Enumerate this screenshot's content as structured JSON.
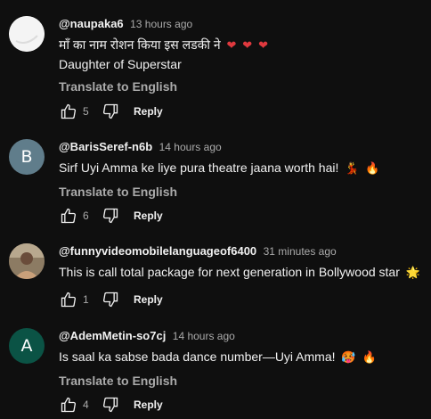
{
  "colors": {
    "background": "#0f0f0f",
    "text": "#f1f1f1",
    "secondary": "#aaaaaa",
    "heart": "#e0393e"
  },
  "comments": [
    {
      "author": "@naupaka6",
      "time": "13 hours ago",
      "avatar_type": "image",
      "avatar_icon": "white-circle-avatar",
      "lines": [
        "माँ का नाम रोशन किया इस लडकी ने",
        "Daughter of Superstar"
      ],
      "emojis": [
        "❤",
        "❤",
        "❤"
      ],
      "translate": "Translate to English",
      "likes": "5",
      "reply": "Reply"
    },
    {
      "author": "@BarisSeref-n6b",
      "time": "14 hours ago",
      "avatar_type": "letter",
      "avatar_letter": "B",
      "avatar_color": "#607d8b",
      "lines": [
        "Sirf Uyi Amma ke liye pura theatre jaana worth hai!"
      ],
      "emojis": [
        "💃",
        "🔥"
      ],
      "translate": "Translate to English",
      "likes": "6",
      "reply": "Reply"
    },
    {
      "author": "@funnyvideomobilelanguageof6400",
      "time": "31 minutes ago",
      "avatar_type": "image",
      "avatar_icon": "profile-photo-avatar",
      "lines": [
        "This is call total package for next generation in Bollywood star"
      ],
      "emojis": [
        "🌟"
      ],
      "likes": "1",
      "reply": "Reply"
    },
    {
      "author": "@AdemMetin-so7cj",
      "time": "14 hours ago",
      "avatar_type": "letter",
      "avatar_letter": "A",
      "avatar_color": "#0b5345",
      "lines": [
        "Is saal ka sabse bada dance number—Uyi Amma!"
      ],
      "emojis": [
        "🥵",
        "🔥"
      ],
      "translate": "Translate to English",
      "likes": "4",
      "reply": "Reply"
    }
  ]
}
